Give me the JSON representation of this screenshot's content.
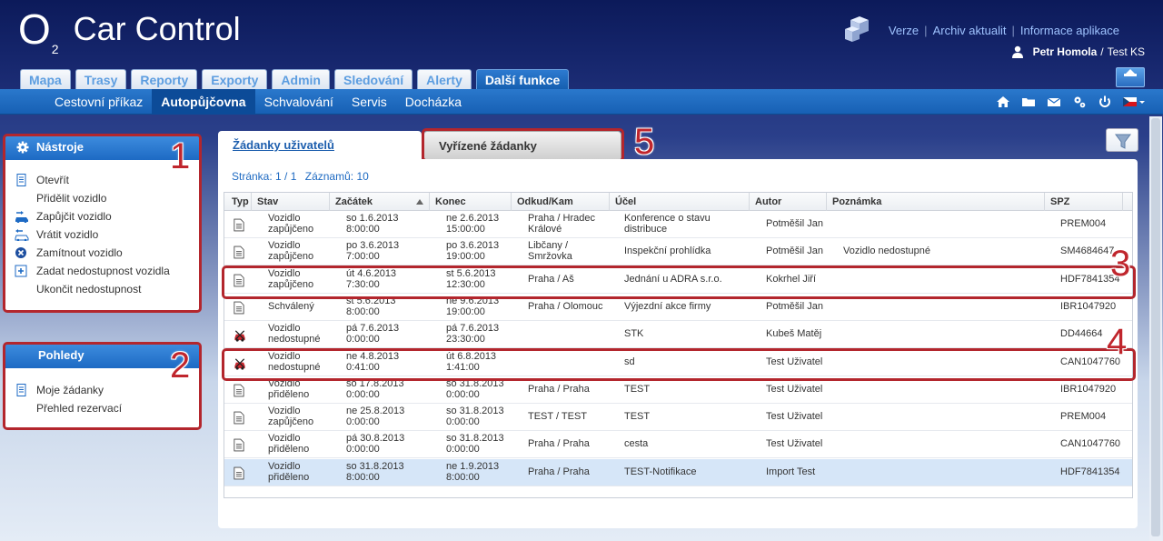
{
  "app": {
    "logo_o": "O",
    "logo_2": "2",
    "title": "Car Control"
  },
  "header_links": [
    "Verze",
    "Archiv aktualit",
    "Informace aplikace"
  ],
  "user": {
    "name": "Petr Homola",
    "separator": "/",
    "role": "Test KS"
  },
  "main_tabs": [
    {
      "label": "Mapa",
      "active": false
    },
    {
      "label": "Trasy",
      "active": false
    },
    {
      "label": "Reporty",
      "active": false
    },
    {
      "label": "Exporty",
      "active": false
    },
    {
      "label": "Admin",
      "active": false
    },
    {
      "label": "Sledování",
      "active": false
    },
    {
      "label": "Alerty",
      "active": false
    },
    {
      "label": "Další funkce",
      "active": true
    }
  ],
  "subnav": [
    {
      "label": "Cestovní příkaz",
      "active": false
    },
    {
      "label": "Autopůjčovna",
      "active": true
    },
    {
      "label": "Schvalování",
      "active": false
    },
    {
      "label": "Servis",
      "active": false
    },
    {
      "label": "Docházka",
      "active": false
    }
  ],
  "subnav_icons": [
    "home-icon",
    "folder-icon",
    "mail-icon",
    "settings-icon",
    "power-icon",
    "flag-cz-icon"
  ],
  "tools_panel": {
    "title": "Nástroje",
    "items": [
      {
        "label": "Otevřít",
        "icon": "document-icon"
      },
      {
        "label": "Přidělit vozidlo",
        "icon": ""
      },
      {
        "label": "Zapůjčit vozidlo",
        "icon": "car-lend-icon"
      },
      {
        "label": "Vrátit vozidlo",
        "icon": "car-return-icon"
      },
      {
        "label": "Zamítnout vozidlo",
        "icon": "reject-icon"
      },
      {
        "label": "Zadat nedostupnost vozidla",
        "icon": "add-icon"
      },
      {
        "label": "Ukončit nedostupnost",
        "icon": ""
      }
    ]
  },
  "views_panel": {
    "title": "Pohledy",
    "items": [
      {
        "label": "Moje žádanky",
        "icon": "document-icon"
      },
      {
        "label": "Přehled rezervací",
        "icon": ""
      }
    ]
  },
  "content_tabs": [
    {
      "label": "Žádanky uživatelů",
      "active": true
    },
    {
      "label": "Vyřízené žádanky",
      "active": false
    }
  ],
  "pager": {
    "page_label": "Stránka:",
    "page": "1 / 1",
    "count_label": "Záznamů:",
    "count": "10"
  },
  "grid": {
    "columns": [
      "Typ",
      "Stav",
      "Začátek",
      "Konec",
      "Odkud/Kam",
      "Účel",
      "Autor",
      "Poznámka",
      "SPZ"
    ],
    "rows": [
      {
        "type": "doc",
        "stav": [
          "Vozidlo",
          "zapůjčeno"
        ],
        "start": [
          "so 1.6.2013",
          "8:00:00"
        ],
        "end": [
          "ne 2.6.2013",
          "15:00:00"
        ],
        "route": [
          "Praha / Hradec",
          "Králové"
        ],
        "purpose": [
          "Konference o stavu",
          "distribuce"
        ],
        "author": "Potměšil Jan",
        "note": "",
        "spz": "PREM004",
        "selected": false
      },
      {
        "type": "doc",
        "stav": [
          "Vozidlo",
          "zapůjčeno"
        ],
        "start": [
          "po 3.6.2013",
          "7:00:00"
        ],
        "end": [
          "po 3.6.2013",
          "19:00:00"
        ],
        "route": [
          "Libčany /",
          "Smržovka"
        ],
        "purpose": [
          "Inspekční prohlídka",
          ""
        ],
        "author": "Potměšil Jan",
        "note": "Vozidlo nedostupné",
        "spz": "SM4684647",
        "selected": false
      },
      {
        "type": "doc",
        "stav": [
          "Vozidlo",
          "zapůjčeno"
        ],
        "start": [
          "út 4.6.2013",
          "7:30:00"
        ],
        "end": [
          "st 5.6.2013",
          "12:30:00"
        ],
        "route": [
          "Praha / Aš",
          ""
        ],
        "purpose": [
          "Jednání u ADRA s.r.o.",
          ""
        ],
        "author": "Kokrhel Jiří",
        "note": "",
        "spz": "HDF7841354",
        "selected": false
      },
      {
        "type": "doc",
        "stav": [
          "Schválený",
          ""
        ],
        "start": [
          "st 5.6.2013",
          "8:00:00"
        ],
        "end": [
          "ne 9.6.2013",
          "19:00:00"
        ],
        "route": [
          "Praha / Olomouc",
          ""
        ],
        "purpose": [
          "Výjezdní akce firmy",
          ""
        ],
        "author": "Potměšil Jan",
        "note": "",
        "spz": "IBR1047920",
        "selected": false
      },
      {
        "type": "car-off",
        "stav": [
          "Vozidlo",
          "nedostupné"
        ],
        "start": [
          "pá 7.6.2013",
          "0:00:00"
        ],
        "end": [
          "pá 7.6.2013",
          "23:30:00"
        ],
        "route": [
          "",
          ""
        ],
        "purpose": [
          "STK",
          ""
        ],
        "author": "Kubeš Matěj",
        "note": "",
        "spz": "DD44664",
        "selected": false
      },
      {
        "type": "car-off",
        "stav": [
          "Vozidlo",
          "nedostupné"
        ],
        "start": [
          "ne 4.8.2013",
          "0:41:00"
        ],
        "end": [
          "út 6.8.2013",
          "1:41:00"
        ],
        "route": [
          "",
          ""
        ],
        "purpose": [
          "sd",
          ""
        ],
        "author": "Test Uživatel",
        "note": "",
        "spz": "CAN1047760",
        "selected": false
      },
      {
        "type": "doc",
        "stav": [
          "Vozidlo",
          "přiděleno"
        ],
        "start": [
          "so 17.8.2013",
          "0:00:00"
        ],
        "end": [
          "so 31.8.2013",
          "0:00:00"
        ],
        "route": [
          "Praha / Praha",
          ""
        ],
        "purpose": [
          "TEST",
          ""
        ],
        "author": "Test Uživatel",
        "note": "",
        "spz": "IBR1047920",
        "selected": false
      },
      {
        "type": "doc",
        "stav": [
          "Vozidlo",
          "zapůjčeno"
        ],
        "start": [
          "ne 25.8.2013",
          "0:00:00"
        ],
        "end": [
          "so 31.8.2013",
          "0:00:00"
        ],
        "route": [
          "TEST / TEST",
          ""
        ],
        "purpose": [
          "TEST",
          ""
        ],
        "author": "Test Uživatel",
        "note": "",
        "spz": "PREM004",
        "selected": false
      },
      {
        "type": "doc",
        "stav": [
          "Vozidlo",
          "přiděleno"
        ],
        "start": [
          "pá 30.8.2013",
          "0:00:00"
        ],
        "end": [
          "so 31.8.2013",
          "0:00:00"
        ],
        "route": [
          "Praha / Praha",
          ""
        ],
        "purpose": [
          "cesta",
          ""
        ],
        "author": "Test Uživatel",
        "note": "",
        "spz": "CAN1047760",
        "selected": false
      },
      {
        "type": "doc",
        "stav": [
          "Vozidlo",
          "přiděleno"
        ],
        "start": [
          "so 31.8.2013",
          "8:00:00"
        ],
        "end": [
          "ne 1.9.2013",
          "8:00:00"
        ],
        "route": [
          "Praha / Praha",
          ""
        ],
        "purpose": [
          "TEST-Notifikace",
          ""
        ],
        "author": "Import Test",
        "note": "",
        "spz": "HDF7841354",
        "selected": true
      }
    ]
  },
  "callouts": [
    "1",
    "2",
    "3",
    "4",
    "5"
  ],
  "colors": {
    "accent": "#1d6ac4",
    "callout": "#c0262d",
    "selection": "#d6e6f8"
  }
}
